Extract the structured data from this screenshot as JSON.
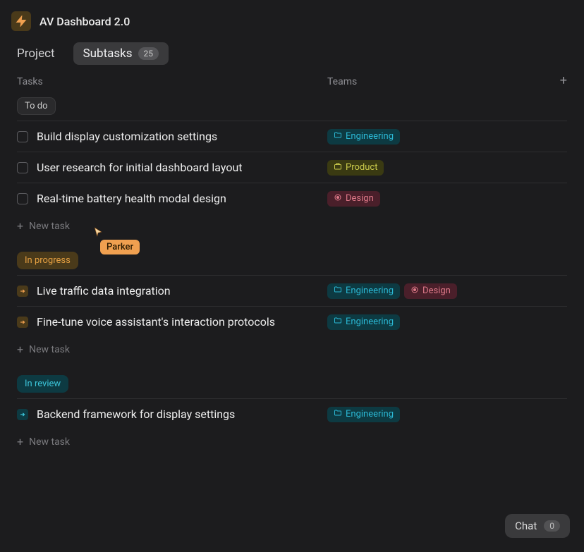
{
  "header": {
    "title": "AV Dashboard 2.0"
  },
  "tabs": {
    "project": "Project",
    "subtasks": "Subtasks",
    "subtasks_count": "25"
  },
  "columns": {
    "tasks": "Tasks",
    "teams": "Teams"
  },
  "sections": [
    {
      "label": "To do",
      "pill_class": "pill-todo",
      "tasks": [
        {
          "title": "Build display customization settings",
          "status": "checkbox",
          "teams": [
            "Engineering"
          ]
        },
        {
          "title": "User research for initial dashboard layout",
          "status": "checkbox",
          "teams": [
            "Product"
          ]
        },
        {
          "title": "Real-time battery health modal design",
          "status": "checkbox",
          "teams": [
            "Design"
          ]
        }
      ]
    },
    {
      "label": "In progress",
      "pill_class": "pill-inprogress",
      "tasks": [
        {
          "title": "Live traffic data integration",
          "status": "orange",
          "teams": [
            "Engineering",
            "Design"
          ]
        },
        {
          "title": "Fine-tune voice assistant's interaction protocols",
          "status": "orange",
          "teams": [
            "Engineering"
          ]
        }
      ]
    },
    {
      "label": "In review",
      "pill_class": "pill-inreview",
      "tasks": [
        {
          "title": "Backend framework for display settings",
          "status": "teal",
          "teams": [
            "Engineering"
          ]
        }
      ]
    }
  ],
  "new_task_label": "New task",
  "cursor": {
    "user": "Parker"
  },
  "chat": {
    "label": "Chat",
    "count": "0"
  },
  "team_meta": {
    "Engineering": {
      "class": "team-engineering",
      "icon": "folder"
    },
    "Product": {
      "class": "team-product",
      "icon": "briefcase"
    },
    "Design": {
      "class": "team-design",
      "icon": "circle"
    }
  }
}
